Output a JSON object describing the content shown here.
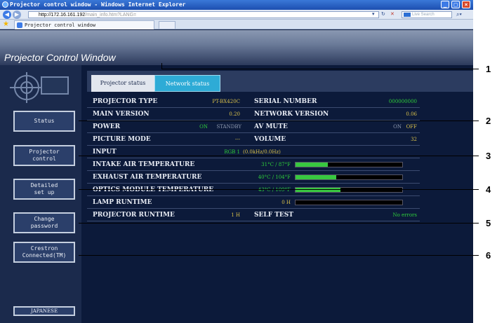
{
  "window": {
    "title": "Projector control window - Windows Internet Explorer",
    "url_host": "http://172.16.161.192",
    "url_path": "/main_info.htm?LANG=",
    "live_search_placeholder": "Live Search",
    "tab_title": "Projector control window"
  },
  "page": {
    "title": "Projector Control Window"
  },
  "sidebar": {
    "buttons": [
      {
        "id": "status",
        "label": "Status"
      },
      {
        "id": "projector-control",
        "label": "Projector\ncontrol"
      },
      {
        "id": "detailed-setup",
        "label": "Detailed\nset up"
      },
      {
        "id": "change-password",
        "label": "Change\npassword"
      },
      {
        "id": "crestron",
        "label": "Crestron\nConnected(TM)"
      }
    ],
    "language_button": "JAPANESE"
  },
  "tabs": [
    {
      "label": "Projector status",
      "active": false
    },
    {
      "label": "Network status",
      "active": true
    }
  ],
  "status": {
    "projector_type": {
      "label": "PROJECTOR TYPE",
      "value": "PT-BX420C"
    },
    "serial_number": {
      "label": "SERIAL NUMBER",
      "value": "000000000"
    },
    "main_version": {
      "label": "MAIN VERSION",
      "value": "0.20"
    },
    "network_version": {
      "label": "NETWORK VERSION",
      "value": "0.06"
    },
    "power": {
      "label": "POWER",
      "on": "ON",
      "standby": "STANDBY"
    },
    "av_mute": {
      "label": "AV MUTE",
      "on": "ON",
      "off": "OFF"
    },
    "picture_mode": {
      "label": "PICTURE MODE",
      "value": "---"
    },
    "volume": {
      "label": "VOLUME",
      "value": "32"
    },
    "input": {
      "label": "INPUT",
      "value": "RGB 1",
      "detail": "(0.0kHz/0.0Hz)"
    },
    "intake_air": {
      "label": "INTAKE AIR TEMPERATURE",
      "value": "31°C / 87°F",
      "level": 0.3
    },
    "exhaust_air": {
      "label": "EXHAUST AIR TEMPERATURE",
      "value": "40°C / 104°F",
      "level": 0.38
    },
    "optics_module": {
      "label": "OPTICS MODULE TEMPERATURE",
      "value": "43°C / 109°F",
      "level": 0.42
    },
    "lamp_runtime": {
      "label": "LAMP RUNTIME",
      "value": "0 H",
      "level": 0.0
    },
    "projector_runtime": {
      "label": "PROJECTOR RUNTIME",
      "value": "1 H"
    },
    "self_test": {
      "label": "SELF TEST",
      "value": "No errors"
    }
  },
  "callouts": [
    "1",
    "2",
    "3",
    "4",
    "5",
    "6"
  ]
}
